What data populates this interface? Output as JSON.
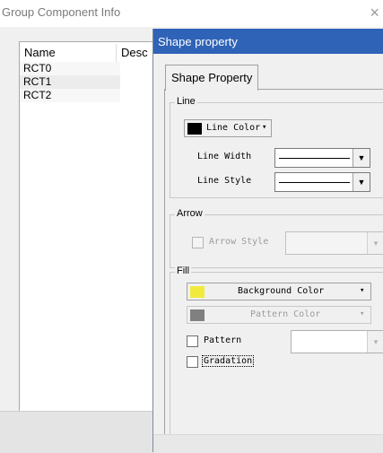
{
  "back_window": {
    "title": "Group Component Info",
    "close_glyph": "×",
    "list": {
      "columns": [
        "Name",
        "Desc"
      ],
      "rows": [
        "RCT0",
        "RCT1",
        "RCT2"
      ]
    }
  },
  "dialog": {
    "title": "Shape property",
    "tab": "Shape Property",
    "line_group": {
      "title": "Line",
      "line_color_label": "Line Color",
      "line_color": "#000000",
      "line_width_label": "Line Width",
      "line_style_label": "Line Style"
    },
    "arrow_group": {
      "title": "Arrow",
      "arrow_style_label": "Arrow Style"
    },
    "fill_group": {
      "title": "Fill",
      "background_color_label": "Background Color",
      "background_color": "#f0ea3c",
      "pattern_color_label": "Pattern Color",
      "pattern_color": "#808080",
      "pattern_label": "Pattern",
      "gradation_label": "Gradation"
    }
  },
  "glyphs": {
    "dropdown": "▼",
    "small_dropdown": "▾"
  },
  "colors": {
    "titlebar": "#2f63b7",
    "window_bg": "#f0f0f0"
  },
  "icons": [
    "close-icon",
    "chevron-down-icon"
  ]
}
